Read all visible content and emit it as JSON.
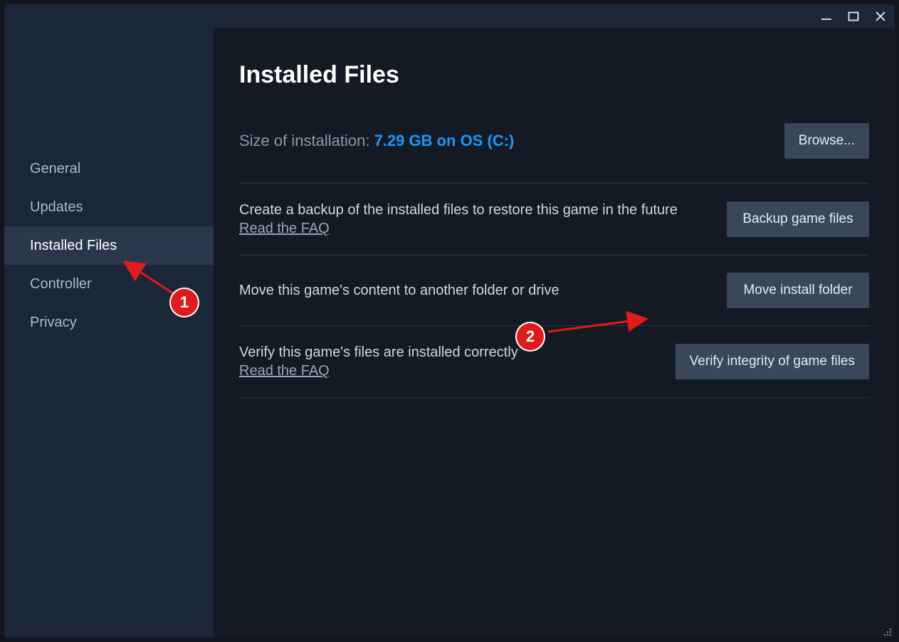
{
  "sidebar": {
    "items": [
      {
        "label": "General"
      },
      {
        "label": "Updates"
      },
      {
        "label": "Installed Files"
      },
      {
        "label": "Controller"
      },
      {
        "label": "Privacy"
      }
    ]
  },
  "main": {
    "title": "Installed Files",
    "size_label": "Size of installation:",
    "size_value": "7.29 GB on OS (C:)",
    "browse_button": "Browse...",
    "sections": {
      "backup": {
        "desc": "Create a backup of the installed files to restore this game in the future",
        "faq": "Read the FAQ",
        "button": "Backup game files"
      },
      "move": {
        "desc": "Move this game's content to another folder or drive",
        "button": "Move install folder"
      },
      "verify": {
        "desc": "Verify this game's files are installed correctly",
        "faq": "Read the FAQ",
        "button": "Verify integrity of game files"
      }
    }
  },
  "annotations": {
    "one": "1",
    "two": "2"
  }
}
